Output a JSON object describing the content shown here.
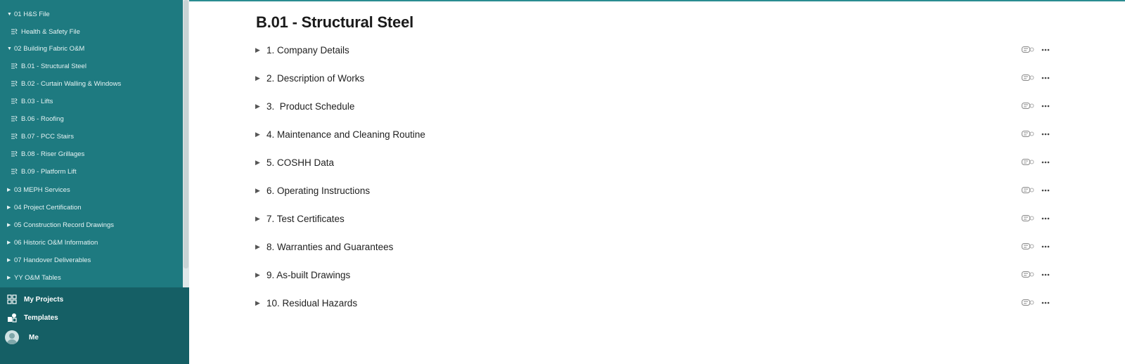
{
  "sidebar": {
    "tree": [
      {
        "label": "01 H&S File",
        "type": "folder",
        "expanded": true
      },
      {
        "label": "Health & Safety File",
        "type": "doc"
      },
      {
        "label": "02 Building Fabric O&M",
        "type": "folder",
        "expanded": true
      },
      {
        "label": "B.01 - Structural Steel",
        "type": "doc"
      },
      {
        "label": "B.02 - Curtain Walling & Windows",
        "type": "doc"
      },
      {
        "label": "B.03 - Lifts",
        "type": "doc"
      },
      {
        "label": "B.06 - Roofing",
        "type": "doc"
      },
      {
        "label": "B.07 - PCC Stairs",
        "type": "doc"
      },
      {
        "label": "B.08 - Riser Grillages",
        "type": "doc"
      },
      {
        "label": "B.09 - Platform Lift",
        "type": "doc"
      },
      {
        "label": "03 MEPH Services",
        "type": "folder",
        "expanded": false
      },
      {
        "label": "04 Project Certification",
        "type": "folder",
        "expanded": false
      },
      {
        "label": "05 Construction Record Drawings",
        "type": "folder",
        "expanded": false
      },
      {
        "label": "06 Historic O&M Information",
        "type": "folder",
        "expanded": false
      },
      {
        "label": "07 Handover Deliverables",
        "type": "folder",
        "expanded": false
      },
      {
        "label": "YY O&M Tables",
        "type": "folder",
        "expanded": false
      }
    ],
    "nav": [
      {
        "label": "My Projects",
        "icon": "grid-icon"
      },
      {
        "label": "Templates",
        "icon": "templates-icon"
      },
      {
        "label": "Me",
        "icon": "avatar"
      }
    ]
  },
  "main": {
    "title": "B.01 - Structural Steel",
    "sections": [
      "1. Company Details",
      "2. Description of Works",
      "3.  Product Schedule",
      "4. Maintenance and Cleaning Routine",
      "5. COSHH Data",
      "6. Operating Instructions",
      "7. Test Certificates",
      "8. Warranties and Guarantees",
      "9. As-built Drawings",
      "10. Residual Hazards"
    ]
  },
  "colors": {
    "sidebar": "#1e7a80",
    "sidebar_bottom": "#155f65",
    "accent_border": "#2a8c91"
  }
}
